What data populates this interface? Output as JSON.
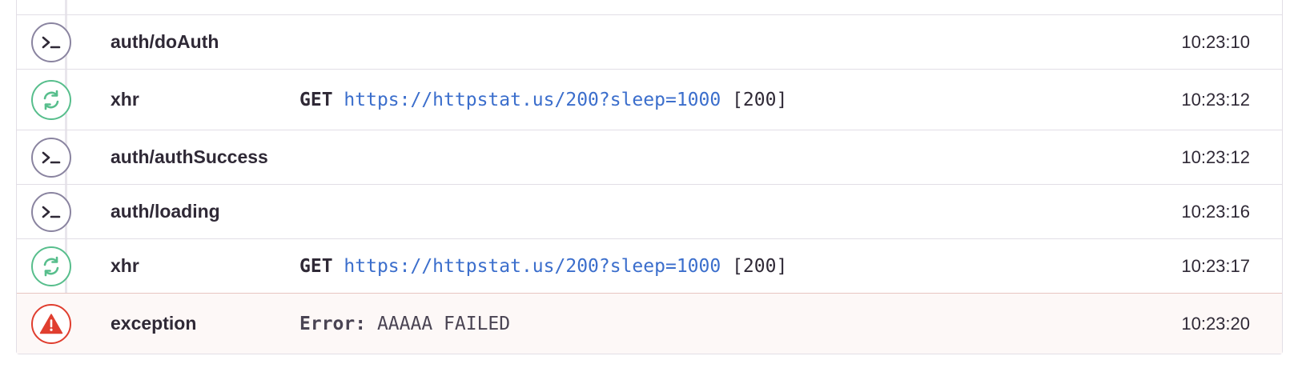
{
  "breadcrumbs": [
    {
      "type": "default",
      "icon": "terminal-prompt-icon",
      "category": "auth/doAuth",
      "message": "",
      "time": "10:23:10"
    },
    {
      "type": "http",
      "icon": "refresh-icon",
      "category": "xhr",
      "method": "GET",
      "url": "https://httpstat.us/200?sleep=1000",
      "status": "[200]",
      "time": "10:23:12"
    },
    {
      "type": "default",
      "icon": "terminal-prompt-icon",
      "category": "auth/authSuccess",
      "message": "",
      "time": "10:23:12"
    },
    {
      "type": "default",
      "icon": "terminal-prompt-icon",
      "category": "auth/loading",
      "message": "",
      "time": "10:23:16"
    },
    {
      "type": "http",
      "icon": "refresh-icon",
      "category": "xhr",
      "method": "GET",
      "url": "https://httpstat.us/200?sleep=1000",
      "status": "[200]",
      "time": "10:23:17"
    },
    {
      "type": "error",
      "icon": "warning-triangle-icon",
      "category": "exception",
      "error_type": "Error:",
      "error_value": "AAAAA FAILED",
      "time": "10:23:20"
    }
  ],
  "colors": {
    "default_icon": "#8a84a0",
    "http_icon": "#57be8c",
    "error_icon": "#e03e2f",
    "url": "#3b6ecc",
    "error_row_bg": "#fdf8f7"
  }
}
